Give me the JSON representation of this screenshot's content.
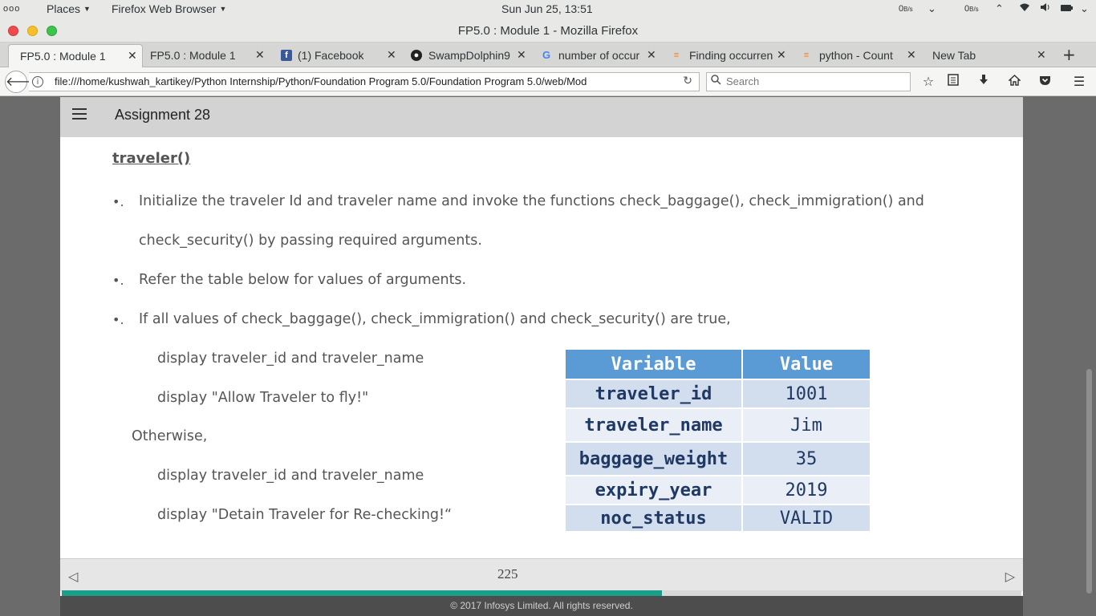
{
  "system_bar": {
    "activities_dots": "ooo",
    "places": "Places",
    "app_menu": "Firefox Web Browser",
    "clock": "Sun Jun 25, 13:51",
    "net_down": "0",
    "net_down_unit": "B/s",
    "net_up": "0",
    "net_up_unit": "B/s"
  },
  "window": {
    "title": "FP5.0 : Module 1 - Mozilla Firefox"
  },
  "tabs": [
    {
      "label": "FP5.0 : Module 1",
      "icon": ""
    },
    {
      "label": "FP5.0 : Module 1",
      "icon": ""
    },
    {
      "label": "(1) Facebook",
      "icon": "facebook-icon"
    },
    {
      "label": "SwampDolphin9",
      "icon": "github-icon"
    },
    {
      "label": "number of occur",
      "icon": "google-icon"
    },
    {
      "label": "Finding occurren",
      "icon": "stackoverflow-icon"
    },
    {
      "label": "python - Count",
      "icon": "stackoverflow-icon"
    },
    {
      "label": "New Tab",
      "icon": ""
    }
  ],
  "navbar": {
    "url": "file:///home/kushwah_kartikey/Python Internship/Python/Foundation Program 5.0/Foundation Program 5.0/web/Mod",
    "search_placeholder": "Search"
  },
  "page": {
    "header_title": "Assignment 28",
    "slide_title": "traveler()",
    "bullet_char": "•.",
    "lines": [
      "Initialize the traveler Id and traveler name and invoke the functions check_baggage(), check_immigration() and",
      "check_security() by passing required arguments.",
      "Refer the table below for values of arguments.",
      "If all values of check_baggage(), check_immigration() and check_security() are true,",
      "display traveler_id and traveler_name",
      "display \"Allow Traveler to fly!\"",
      "Otherwise,",
      "display traveler_id and traveler_name",
      "display \"Detain Traveler for Re-checking!“"
    ],
    "table": {
      "headers": [
        "Variable",
        "Value"
      ],
      "rows": [
        [
          "traveler_id",
          "1001"
        ],
        [
          "traveler_name",
          "Jim"
        ],
        [
          "baggage_weight",
          "35"
        ],
        [
          "expiry_year",
          "2019"
        ],
        [
          "noc_status",
          "VALID"
        ]
      ]
    },
    "page_number": "225",
    "progress_fraction": 0.625,
    "copyright": "© 2017 Infosys Limited. All rights reserved."
  },
  "colors": {
    "table_header": "#5b9bd5",
    "table_text": "#1f3864",
    "progress": "#1a9e8a"
  }
}
